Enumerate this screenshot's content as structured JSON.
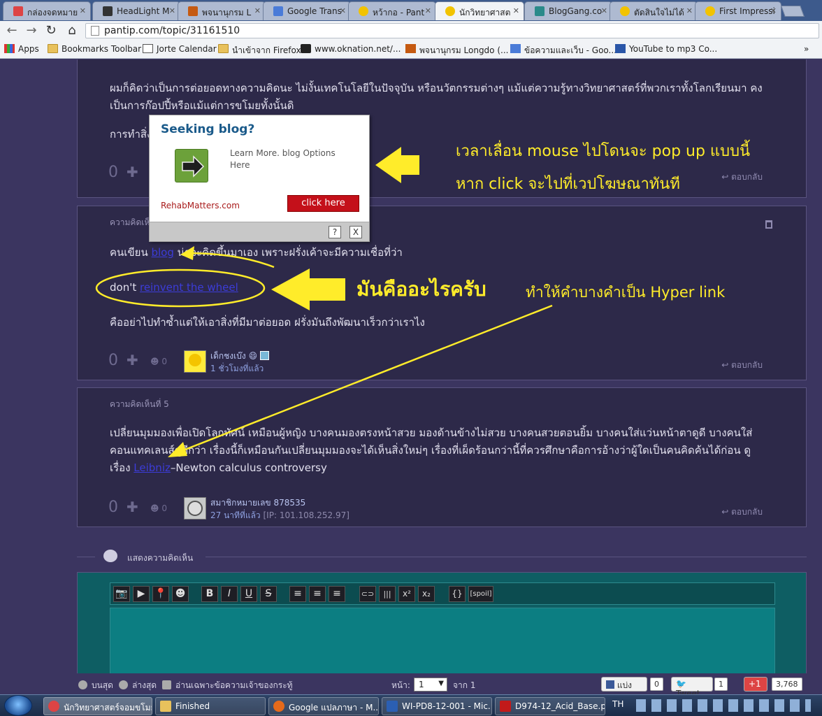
{
  "browser": {
    "tabs": [
      {
        "label": "กล่องจดหมาย",
        "color": "#d44"
      },
      {
        "label": "HeadLight M",
        "color": "#333"
      },
      {
        "label": "พจนานุกรม L",
        "color": "#c55a11"
      },
      {
        "label": "Google Trans",
        "color": "#4a7bd8"
      },
      {
        "label": "หว้ากอ - Pant",
        "color": "#f2c300"
      },
      {
        "label": "นักวิทยาศาสต",
        "color": "#f2c300"
      },
      {
        "label": "BlogGang.co",
        "color": "#2a8a8a"
      },
      {
        "label": "ตัดสินใจไม่ได้",
        "color": "#f2c300"
      },
      {
        "label": "First Impressi",
        "color": "#f2c300"
      }
    ],
    "url": "pantip.com/topic/31161510",
    "bookmarks": [
      {
        "label": "Apps"
      },
      {
        "label": "Bookmarks Toolbar"
      },
      {
        "label": "Jorte Calendar"
      },
      {
        "label": "นำเข้าจาก Firefox"
      },
      {
        "label": "www.oknation.net/..."
      },
      {
        "label": "พจนานุกรม Longdo (..."
      },
      {
        "label": "ข้อความและเว็บ - Goo..."
      },
      {
        "label": "YouTube to mp3 Co..."
      }
    ]
  },
  "comments": {
    "c3": {
      "text_line1": "ผมก็คิดว่าเป็นการต่อยอดทางความคิดนะ ไม่งั้นเทคโนโลยีในปัจจุบัน หรือนวัตกรรมต่างๆ แม้แต่ความรู้ทางวิทยาศาสตร์ที่พวกเราทั้งโลกเรียนมา คง",
      "text_line2": "เป็นการก๊อปปี้หรือแม้แต่การขโมยทั้งนั้นดิ",
      "text_line3": "การทำสิ่ง",
      "votes": "0",
      "reply": "ตอบกลับ"
    },
    "c4": {
      "label": "ความคิดเห็",
      "text1_before": "คนเขียน ",
      "text1_link": "blog",
      "text1_after": " น่าจะคิดขึ้นมาเอง เพราะฝรั่งเค้าจะมีความเชื่อที่ว่า",
      "text2_before": "don't ",
      "text2_link": "reinvent the wheel",
      "text3": "คืออย่าไปทำซ้ำแต่ให้เอาสิ่งที่มีมาต่อยอด ฝรั่งมันถึงพัฒนาเร็วกว่าเราไง",
      "votes": "0",
      "emo_count": "0",
      "user": "เด็กชงเบ๊ง",
      "time": "1 ชั่วโมงที่แล้ว",
      "reply": "ตอบกลับ"
    },
    "c5": {
      "label": "ความคิดเห็นที่ 5",
      "line1": "เปลี่ยนมุมมองเพื่อเปิดโลกทัศน์ เหมือนผู้หญิง บางคนมองตรงหน้าสวย มองด้านข้างไม่สวย บางคนสวยตอนยิ้ม บางคนใส่แว่นหน้าตาดูดี บางคนใส่",
      "line2": "คอนแทคเลนส์ดูดีกว่า เรื่องนี้ก็เหมือนกันเปลี่ยนมุมมองจะได้เห็นสิ่งใหม่ๆ เรื่องที่เผ็ดร้อนกว่านี้ที่ควรศึกษาคือการอ้างว่าผู้ใดเป็นคนคิดค้นได้ก่อน ดู",
      "line3_before": "เรื่อง ",
      "line3_link": "Leibniz",
      "line3_after": "–Newton calculus controversy",
      "votes": "0",
      "emo_count": "0",
      "user": "สมาชิกหมายเลข 878535",
      "time": "27 นาทีที่แล้ว",
      "ip": "[IP: 101.108.252.97]",
      "reply": "ตอบกลับ"
    }
  },
  "comment_section_label": "แสดงความคิดเห็น",
  "editor": {
    "tools": [
      "📷",
      "▶",
      "📍",
      "☻",
      "B",
      "I",
      "U",
      "S",
      "≡",
      "≡",
      "≡",
      "⊂⊃",
      "|||",
      "x²",
      "x₂",
      "{}",
      "[spoil]"
    ]
  },
  "ad": {
    "title": "Seeking blog?",
    "text": "Learn More. blog Options Here",
    "site": "RehabMatters.com",
    "button": "click here",
    "help": "?",
    "close": "X"
  },
  "annotations": {
    "a1_line1": "เวลาเลื่อน mouse ไปโดนจะ pop up แบบนี้",
    "a1_line2": "หาก click จะไปที่เวปโฆษณาทันที",
    "a2_main": "มันคืออะไรครับ",
    "a2_sub": "ทำให้คำบางคำเป็น Hyper link",
    "color": "#ffec2a"
  },
  "pagebar": {
    "latest": "บนสุด",
    "bottom": "ล่างสุด",
    "owner_only": "อ่านเฉพาะข้อความเจ้าของกระทู้",
    "page_label": "หน้า:",
    "page_value": "1",
    "of_label": "จาก 1",
    "fb_share": "แบ่งปัน",
    "fb_count": "0",
    "tweet": "Tweet",
    "tweet_count": "1",
    "gplus": "+1",
    "gplus_count": "3,768"
  },
  "taskbar": {
    "items": [
      {
        "label": "นักวิทยาศาสตร์จอมขโมย...",
        "color": "#d44"
      },
      {
        "label": "Finished",
        "color": "#e8c15c"
      },
      {
        "label": "Google แปลภาษา - M...",
        "color": "#e66a1a"
      },
      {
        "label": "WI-PD8-12-001 - Mic...",
        "color": "#2b5fb3"
      },
      {
        "label": "D974-12_Acid_Base.p...",
        "color": "#c21a1a"
      }
    ],
    "lang": "TH"
  }
}
